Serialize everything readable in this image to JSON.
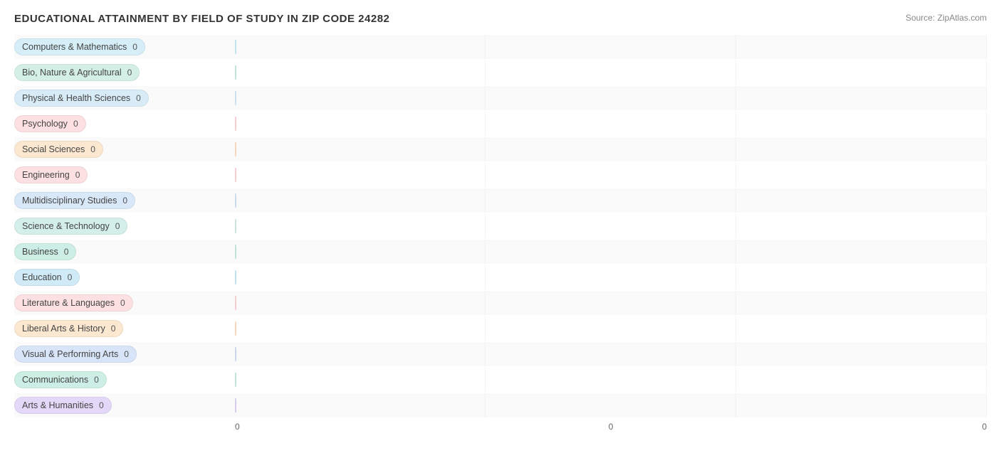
{
  "chart": {
    "title": "EDUCATIONAL ATTAINMENT BY FIELD OF STUDY IN ZIP CODE 24282",
    "source": "Source: ZipAtlas.com",
    "x_axis_labels": [
      "0",
      "0",
      "0"
    ],
    "bars": [
      {
        "label": "Computers & Mathematics",
        "value": "0",
        "color": "#a8d8e8",
        "pill_bg": "#d6eef8"
      },
      {
        "label": "Bio, Nature & Agricultural",
        "value": "0",
        "color": "#a8d8c8",
        "pill_bg": "#d4f0e6"
      },
      {
        "label": "Physical & Health Sciences",
        "value": "0",
        "color": "#b8d4e8",
        "pill_bg": "#d8ecf8"
      },
      {
        "label": "Psychology",
        "value": "0",
        "color": "#f4b8bc",
        "pill_bg": "#fce0e2"
      },
      {
        "label": "Social Sciences",
        "value": "0",
        "color": "#f4c8a0",
        "pill_bg": "#fce8d0"
      },
      {
        "label": "Engineering",
        "value": "0",
        "color": "#f4b8bc",
        "pill_bg": "#fce0e2"
      },
      {
        "label": "Multidisciplinary Studies",
        "value": "0",
        "color": "#b8cce8",
        "pill_bg": "#d8e8f8"
      },
      {
        "label": "Science & Technology",
        "value": "0",
        "color": "#b8d8d0",
        "pill_bg": "#d4eeea"
      },
      {
        "label": "Business",
        "value": "0",
        "color": "#a8d8c8",
        "pill_bg": "#cceee4"
      },
      {
        "label": "Education",
        "value": "0",
        "color": "#a8d4e8",
        "pill_bg": "#d0eaf8"
      },
      {
        "label": "Literature & Languages",
        "value": "0",
        "color": "#f4b8bc",
        "pill_bg": "#fce0e2"
      },
      {
        "label": "Liberal Arts & History",
        "value": "0",
        "color": "#f4c8a0",
        "pill_bg": "#fce8d0"
      },
      {
        "label": "Visual & Performing Arts",
        "value": "0",
        "color": "#b8c8e8",
        "pill_bg": "#d8e4f8"
      },
      {
        "label": "Communications",
        "value": "0",
        "color": "#a8d8c8",
        "pill_bg": "#cceee4"
      },
      {
        "label": "Arts & Humanities",
        "value": "0",
        "color": "#c8b8e8",
        "pill_bg": "#e4d8f8"
      }
    ]
  }
}
